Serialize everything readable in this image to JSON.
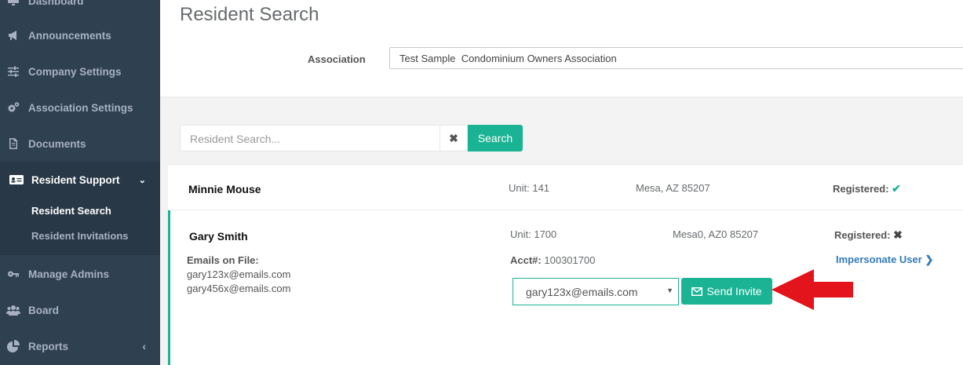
{
  "sidebar": {
    "items": [
      {
        "label": "Dashboard",
        "icon": "monitor-icon"
      },
      {
        "label": "Announcements",
        "icon": "megaphone-icon"
      },
      {
        "label": "Company Settings",
        "icon": "sliders-icon"
      },
      {
        "label": "Association Settings",
        "icon": "cogs-icon"
      },
      {
        "label": "Documents",
        "icon": "document-icon"
      },
      {
        "label": "Resident Support",
        "icon": "id-card-icon"
      },
      {
        "label": "Manage Admins",
        "icon": "key-icon"
      },
      {
        "label": "Board",
        "icon": "users-icon"
      },
      {
        "label": "Reports",
        "icon": "pie-chart-icon"
      }
    ],
    "sub_items": [
      "Resident Search",
      "Resident Invitations"
    ]
  },
  "header": {
    "title": "Resident Search",
    "association_label": "Association",
    "association_value": "Test Sample  Condominium Owners Association"
  },
  "search": {
    "placeholder": "Resident Search...",
    "button_label": "Search",
    "clear_glyph": "✖"
  },
  "residents": [
    {
      "name": "Minnie Mouse",
      "unit": "Unit: 141",
      "location": "Mesa, AZ 85207",
      "registered_label": "Registered:",
      "registered": true
    },
    {
      "name": "Gary Smith",
      "unit": "Unit: 1700",
      "location": "Mesa0, AZ0 85207",
      "registered_label": "Registered:",
      "registered": false,
      "emails_label": "Emails on File:",
      "emails": [
        "gary123x@emails.com",
        "gary456x@emails.com"
      ],
      "acct_label": "Acct#:",
      "acct": "100301700",
      "impersonate_label": "Impersonate User",
      "selected_email": "gary123x@emails.com",
      "send_invite_label": "Send Invite"
    }
  ],
  "colors": {
    "sidebar_bg": "#2f4050",
    "accent": "#1ab394",
    "link": "#337ab7",
    "annotation_arrow": "#e3141b"
  }
}
